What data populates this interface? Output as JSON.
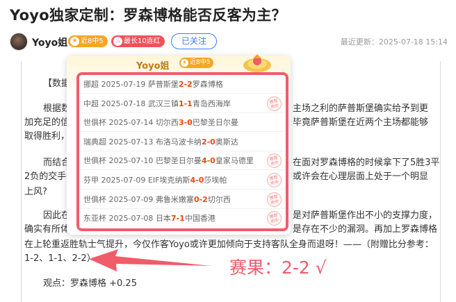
{
  "article": {
    "title": "Yoyo独家定制：罗森博格能否反客为主？",
    "author": "Yoyo姐",
    "badge_recent": "近8中5",
    "badge_streak": "最长10连红",
    "follow_label": "已关注",
    "update_text": "最近更新：2025-07-18 15:14"
  },
  "body": {
    "p1": "【数据",
    "p2a_left": "根据数",
    "p2a_right": "主场之利的萨普斯堡确实给予到更",
    "p2b_left": "加充足的信",
    "p2b_right": "毕竟萨普斯堡在近两个主场都能够",
    "p2c": "取得胜利，",
    "p3a_left": "而结合",
    "p3a_right": "在面对罗森博格的时候拿下了5胜3平",
    "p3b_left": "2负的交手记",
    "p3b_right": "或许会在心理层面上处于一个明显",
    "p3c": "上风?",
    "p4a_left": "因此在",
    "p4a_right": "是对萨普斯堡作出不小的支撑力度，",
    "p4b_left": "确实有所体",
    "p4b_right": "是存在不少的漏洞。再加上罗森博格",
    "p4c": "在上轮重返胜轨士气提升，今仅作客Yoyo或许更加倾向于支持客队全身而退呀！——（附赠比分参考：",
    "p4d": "1-2、1-1、2-2）",
    "viewpoint": "观点：罗森博格 +0.25"
  },
  "popup": {
    "name": "Yoyo姐",
    "badge": "近8中5",
    "stamp_text_1": "推荐",
    "stamp_text_2": "命中",
    "rows": [
      {
        "league": "挪超",
        "date": "2025-07-19",
        "home": "萨普斯堡",
        "hs": "2",
        "sep": "-",
        "as": "2",
        "away": "罗森博格",
        "hit": false
      },
      {
        "league": "中超",
        "date": "2025-07-18",
        "home": "武汉三镇",
        "hs": "1",
        "sep": "-",
        "as": "1",
        "away": "青岛西海岸",
        "hit": true
      },
      {
        "league": "世俱杯",
        "date": "2025-07-14",
        "home": "切尔西",
        "hs": "3",
        "sep": "-",
        "as": "0",
        "away": "巴黎圣日尔曼",
        "hit": false
      },
      {
        "league": "瑞典超",
        "date": "2025-07-13",
        "home": "布洛马波卡纳",
        "hs": "2",
        "sep": "-",
        "as": "0",
        "away": "奥斯达",
        "hit": false
      },
      {
        "league": "世俱杯",
        "date": "2025-07-10",
        "home": "巴黎圣日尔曼",
        "hs": "4",
        "sep": "-",
        "as": "0",
        "away": "皇家马德里",
        "hit": true
      },
      {
        "league": "芬甲",
        "date": "2025-07-09",
        "home": "EIF埃克纳斯",
        "hs": "4",
        "sep": "-",
        "as": "0",
        "away": "莎埃帕",
        "hit": true
      },
      {
        "league": "世俱杯",
        "date": "2025-07-09",
        "home": "弗鲁米嫩塞",
        "hs": "0",
        "sep": "-",
        "as": "2",
        "away": "切尔西",
        "hit": true
      },
      {
        "league": "东亚杯",
        "date": "2025-07-08",
        "home": "日本",
        "hs": "7",
        "sep": "-",
        "as": "1",
        "away": "中国香港",
        "hit": true
      }
    ]
  },
  "result": "赛果：2-2 √",
  "colors": {
    "accent_red": "#f05c6a",
    "score_orange": "#e8490f",
    "follow_blue": "#3b7cff",
    "badge_orange": "#f5a623"
  }
}
